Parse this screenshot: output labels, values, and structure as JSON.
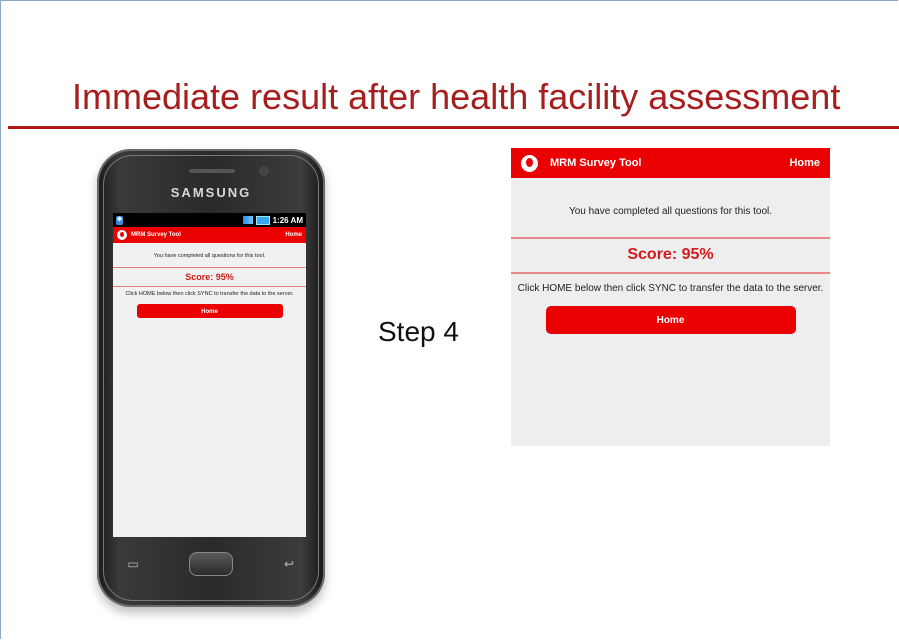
{
  "slide": {
    "title": "Immediate result after health facility assessment",
    "step_label": "Step 4"
  },
  "phone": {
    "brand": "SAMSUNG",
    "status_time": "1:26 AM"
  },
  "app": {
    "title": "MRM Survey Tool",
    "home_link": "Home",
    "completion_message": "You have completed all questions for this tool.",
    "score_text": "Score: 95%",
    "instruction": "Click HOME below then click SYNC to transfer the data to the server.",
    "home_button": "Home",
    "accent_color": "#ea0000"
  },
  "icons": [
    "vodafone-logo-icon",
    "bluetooth-icon",
    "signal-icon",
    "battery-icon",
    "menu-key-icon",
    "back-key-icon"
  ]
}
